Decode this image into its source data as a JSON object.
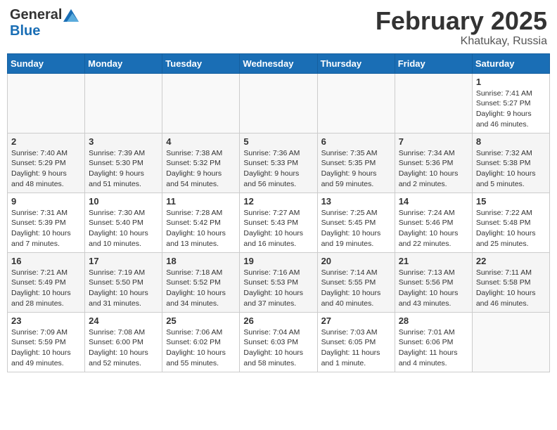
{
  "logo": {
    "general": "General",
    "blue": "Blue"
  },
  "title": {
    "month": "February 2025",
    "location": "Khatukay, Russia"
  },
  "weekdays": [
    "Sunday",
    "Monday",
    "Tuesday",
    "Wednesday",
    "Thursday",
    "Friday",
    "Saturday"
  ],
  "weeks": [
    [
      {
        "day": "",
        "info": ""
      },
      {
        "day": "",
        "info": ""
      },
      {
        "day": "",
        "info": ""
      },
      {
        "day": "",
        "info": ""
      },
      {
        "day": "",
        "info": ""
      },
      {
        "day": "",
        "info": ""
      },
      {
        "day": "1",
        "info": "Sunrise: 7:41 AM\nSunset: 5:27 PM\nDaylight: 9 hours and 46 minutes."
      }
    ],
    [
      {
        "day": "2",
        "info": "Sunrise: 7:40 AM\nSunset: 5:29 PM\nDaylight: 9 hours and 48 minutes."
      },
      {
        "day": "3",
        "info": "Sunrise: 7:39 AM\nSunset: 5:30 PM\nDaylight: 9 hours and 51 minutes."
      },
      {
        "day": "4",
        "info": "Sunrise: 7:38 AM\nSunset: 5:32 PM\nDaylight: 9 hours and 54 minutes."
      },
      {
        "day": "5",
        "info": "Sunrise: 7:36 AM\nSunset: 5:33 PM\nDaylight: 9 hours and 56 minutes."
      },
      {
        "day": "6",
        "info": "Sunrise: 7:35 AM\nSunset: 5:35 PM\nDaylight: 9 hours and 59 minutes."
      },
      {
        "day": "7",
        "info": "Sunrise: 7:34 AM\nSunset: 5:36 PM\nDaylight: 10 hours and 2 minutes."
      },
      {
        "day": "8",
        "info": "Sunrise: 7:32 AM\nSunset: 5:38 PM\nDaylight: 10 hours and 5 minutes."
      }
    ],
    [
      {
        "day": "9",
        "info": "Sunrise: 7:31 AM\nSunset: 5:39 PM\nDaylight: 10 hours and 7 minutes."
      },
      {
        "day": "10",
        "info": "Sunrise: 7:30 AM\nSunset: 5:40 PM\nDaylight: 10 hours and 10 minutes."
      },
      {
        "day": "11",
        "info": "Sunrise: 7:28 AM\nSunset: 5:42 PM\nDaylight: 10 hours and 13 minutes."
      },
      {
        "day": "12",
        "info": "Sunrise: 7:27 AM\nSunset: 5:43 PM\nDaylight: 10 hours and 16 minutes."
      },
      {
        "day": "13",
        "info": "Sunrise: 7:25 AM\nSunset: 5:45 PM\nDaylight: 10 hours and 19 minutes."
      },
      {
        "day": "14",
        "info": "Sunrise: 7:24 AM\nSunset: 5:46 PM\nDaylight: 10 hours and 22 minutes."
      },
      {
        "day": "15",
        "info": "Sunrise: 7:22 AM\nSunset: 5:48 PM\nDaylight: 10 hours and 25 minutes."
      }
    ],
    [
      {
        "day": "16",
        "info": "Sunrise: 7:21 AM\nSunset: 5:49 PM\nDaylight: 10 hours and 28 minutes."
      },
      {
        "day": "17",
        "info": "Sunrise: 7:19 AM\nSunset: 5:50 PM\nDaylight: 10 hours and 31 minutes."
      },
      {
        "day": "18",
        "info": "Sunrise: 7:18 AM\nSunset: 5:52 PM\nDaylight: 10 hours and 34 minutes."
      },
      {
        "day": "19",
        "info": "Sunrise: 7:16 AM\nSunset: 5:53 PM\nDaylight: 10 hours and 37 minutes."
      },
      {
        "day": "20",
        "info": "Sunrise: 7:14 AM\nSunset: 5:55 PM\nDaylight: 10 hours and 40 minutes."
      },
      {
        "day": "21",
        "info": "Sunrise: 7:13 AM\nSunset: 5:56 PM\nDaylight: 10 hours and 43 minutes."
      },
      {
        "day": "22",
        "info": "Sunrise: 7:11 AM\nSunset: 5:58 PM\nDaylight: 10 hours and 46 minutes."
      }
    ],
    [
      {
        "day": "23",
        "info": "Sunrise: 7:09 AM\nSunset: 5:59 PM\nDaylight: 10 hours and 49 minutes."
      },
      {
        "day": "24",
        "info": "Sunrise: 7:08 AM\nSunset: 6:00 PM\nDaylight: 10 hours and 52 minutes."
      },
      {
        "day": "25",
        "info": "Sunrise: 7:06 AM\nSunset: 6:02 PM\nDaylight: 10 hours and 55 minutes."
      },
      {
        "day": "26",
        "info": "Sunrise: 7:04 AM\nSunset: 6:03 PM\nDaylight: 10 hours and 58 minutes."
      },
      {
        "day": "27",
        "info": "Sunrise: 7:03 AM\nSunset: 6:05 PM\nDaylight: 11 hours and 1 minute."
      },
      {
        "day": "28",
        "info": "Sunrise: 7:01 AM\nSunset: 6:06 PM\nDaylight: 11 hours and 4 minutes."
      },
      {
        "day": "",
        "info": ""
      }
    ]
  ]
}
